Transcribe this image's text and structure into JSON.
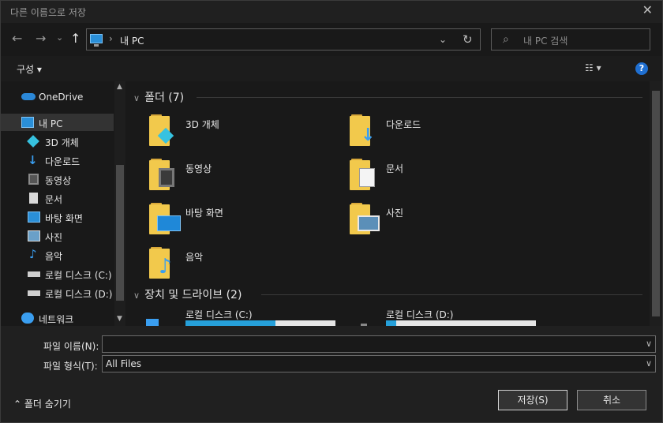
{
  "window": {
    "title": "다른 이름으로 저장",
    "close_glyph": "✕"
  },
  "nav": {
    "back_glyph": "←",
    "forward_glyph": "→",
    "recent_glyph": "⌄",
    "up_glyph": "↑",
    "address_sep": "›",
    "address_path": "내 PC",
    "address_dd": "⌄",
    "refresh_glyph": "↻",
    "search_placeholder": "내 PC 검색",
    "search_glyph": "⌕"
  },
  "toolbar": {
    "organize": "구성 ▾",
    "view": "☷ ▾",
    "help": "?"
  },
  "sidebar": {
    "items": [
      {
        "label": "OneDrive",
        "icon": "onedrive-icon",
        "color": "#2b88d8"
      },
      {
        "label": "내 PC",
        "icon": "pc-icon",
        "color": "#2a8fd8"
      },
      {
        "label": "3D 개체",
        "icon": "3d-objects-icon",
        "color": "#36c2e0"
      },
      {
        "label": "다운로드",
        "icon": "download-icon",
        "color": "#3a9ef0"
      },
      {
        "label": "동영상",
        "icon": "video-icon",
        "color": "#8a8a8a"
      },
      {
        "label": "문서",
        "icon": "document-icon",
        "color": "#d8d8d8"
      },
      {
        "label": "바탕 화면",
        "icon": "desktop-icon",
        "color": "#2a8fd8"
      },
      {
        "label": "사진",
        "icon": "pictures-icon",
        "color": "#6aa0c8"
      },
      {
        "label": "음악",
        "icon": "music-icon",
        "color": "#3a9ef0"
      },
      {
        "label": "로컬 디스크 (C:)",
        "icon": "drive-c-icon",
        "color": "#cfcfcf"
      },
      {
        "label": "로컬 디스크 (D:)",
        "icon": "drive-d-icon",
        "color": "#cfcfcf"
      },
      {
        "label": "네트워크",
        "icon": "network-icon",
        "color": "#3a9ef0"
      }
    ]
  },
  "main": {
    "folders_header": "폴더 (7)",
    "folders": [
      {
        "label": "3D 개체",
        "icon": "3d-objects-folder-icon"
      },
      {
        "label": "다운로드",
        "icon": "downloads-folder-icon"
      },
      {
        "label": "동영상",
        "icon": "videos-folder-icon"
      },
      {
        "label": "문서",
        "icon": "documents-folder-icon"
      },
      {
        "label": "바탕 화면",
        "icon": "desktop-folder-icon"
      },
      {
        "label": "사진",
        "icon": "pictures-folder-icon"
      },
      {
        "label": "음악",
        "icon": "music-folder-icon"
      }
    ],
    "devices_header": "장치 및 드라이브 (2)",
    "drives": [
      {
        "label": "로컬 디스크 (C:)",
        "used_fraction": 0.6
      },
      {
        "label": "로컬 디스크 (D:)",
        "used_fraction": 0.07
      }
    ]
  },
  "bottom": {
    "filename_label": "파일 이름(N):",
    "filename_value": "",
    "filetype_label": "파일 형식(T):",
    "filetype_value": "All Files",
    "hide_folders": "⌃  폴더 숨기기",
    "save": "저장(S)",
    "cancel": "취소"
  },
  "colors": {
    "accent": "#26a0da",
    "folder": "#f2c94c",
    "background": "#191919"
  }
}
